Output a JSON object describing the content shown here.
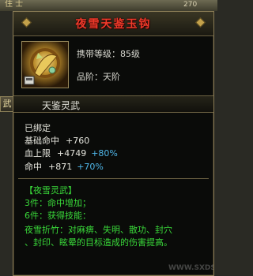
{
  "background": {
    "top_text": "住 士",
    "top_number": "270"
  },
  "left_tab": "武",
  "item": {
    "name": "夜雪天鉴玉钩",
    "level_requirement": "携带等级：85级",
    "grade": "品阶：天阶",
    "subname": "天鉴灵武"
  },
  "stats": {
    "bound": "已绑定",
    "rows": [
      {
        "label": "基础命中",
        "value": "+760",
        "percent": ""
      },
      {
        "label": "血上限",
        "value": "+4749",
        "percent": "+80%"
      },
      {
        "label": "命中",
        "value": "+871",
        "percent": "+70%"
      }
    ]
  },
  "set": {
    "title": "【夜雪灵武】",
    "piece3": "3件：命中增加；",
    "piece6": "6件：获得技能：",
    "skill_line1": "夜雪折竹：对麻痹、失明、散功、封穴",
    "skill_line2": "、封印、眩晕的目标造成的伤害提高。"
  },
  "watermark": "WWW.SXDS.COM",
  "colors": {
    "title": "#ee3a2a",
    "set_text": "#39d839",
    "percent": "#4fb6e8",
    "border": "#8a7c55"
  }
}
